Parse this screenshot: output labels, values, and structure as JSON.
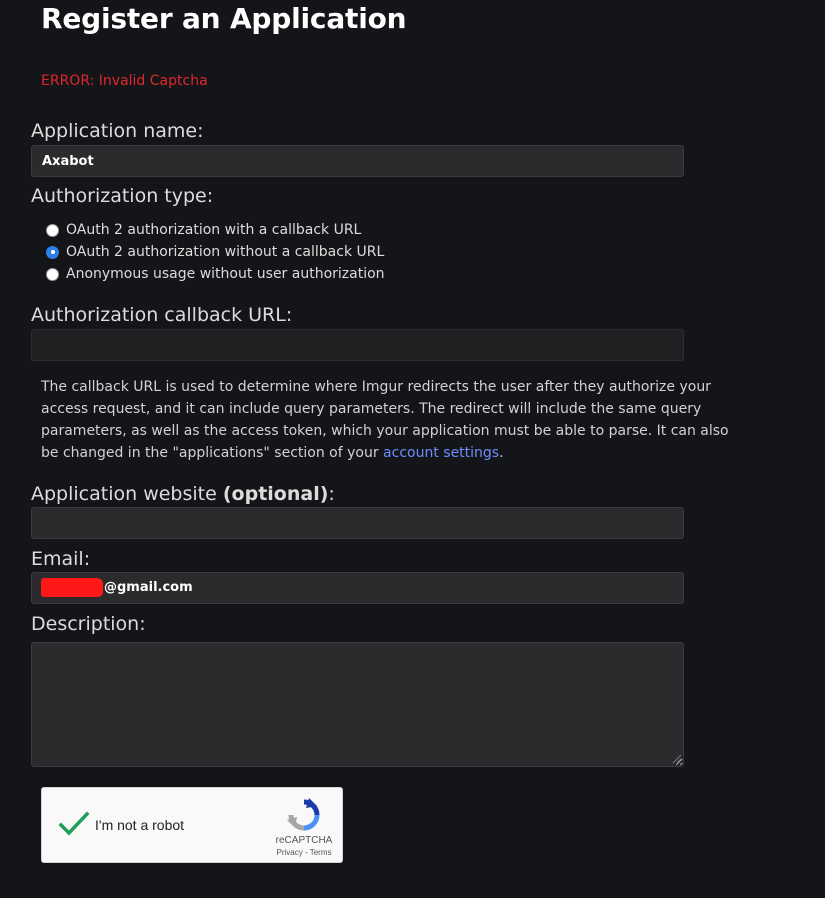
{
  "page": {
    "title": "Register an Application",
    "error": "ERROR: Invalid Captcha"
  },
  "form": {
    "app_name": {
      "label": "Application name:",
      "value": "Axabot"
    },
    "auth_type": {
      "label": "Authorization type:",
      "options": [
        {
          "label": "OAuth 2 authorization with a callback URL",
          "checked": false
        },
        {
          "label": "OAuth 2 authorization without a callback URL",
          "checked": true
        },
        {
          "label": "Anonymous usage without user authorization",
          "checked": false
        }
      ]
    },
    "callback_url": {
      "label": "Authorization callback URL:",
      "value": "",
      "help_text": "The callback URL is used to determine where Imgur redirects the user after they authorize your access request, and it can include query parameters. The redirect will include the same query parameters, as well as the access token, which your application must be able to parse. It can also be changed in the \"applications\" section of your",
      "help_link": "account settings",
      "help_end": "."
    },
    "website": {
      "label": "Application website ",
      "label_bold": "(optional)",
      "label_suffix": ":",
      "value": ""
    },
    "email": {
      "label": "Email:",
      "value_visible": "@gmail.com"
    },
    "description": {
      "label": "Description:",
      "value": ""
    }
  },
  "captcha": {
    "label": "I'm not a robot",
    "brand": "reCAPTCHA",
    "privacy": "Privacy",
    "separator": " - ",
    "terms": "Terms",
    "checked": true
  },
  "colors": {
    "background": "#141518",
    "error": "#e0272d",
    "link": "#6e8cff",
    "radio_selected": "#2f7fe6",
    "captcha_check": "#1e9e5a"
  }
}
